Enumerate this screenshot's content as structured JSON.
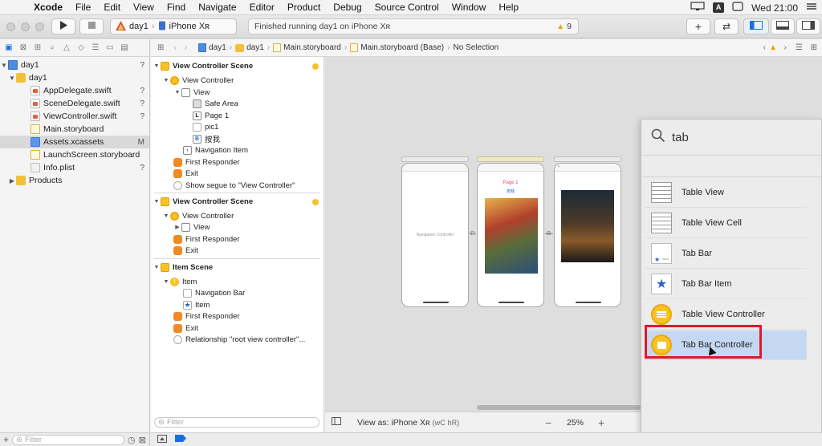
{
  "menubar": {
    "app_name": "Xcode",
    "items": [
      "File",
      "Edit",
      "View",
      "Find",
      "Navigate",
      "Editor",
      "Product",
      "Debug",
      "Source Control",
      "Window",
      "Help"
    ],
    "input_badge": "A",
    "clock": "Wed 21:00"
  },
  "toolbar": {
    "scheme_name": "day1",
    "device_name": "iPhone Xʀ",
    "status_text": "Finished running day1 on iPhone Xʀ",
    "warning_count": "9"
  },
  "navigator": {
    "items": [
      {
        "label": "day1",
        "flag": "?"
      },
      {
        "label": "day1",
        "flag": ""
      },
      {
        "label": "AppDelegate.swift",
        "flag": "?"
      },
      {
        "label": "SceneDelegate.swift",
        "flag": "?"
      },
      {
        "label": "ViewController.swift",
        "flag": "?"
      },
      {
        "label": "Main.storyboard",
        "flag": ""
      },
      {
        "label": "Assets.xcassets",
        "flag": "M"
      },
      {
        "label": "LaunchScreen.storyboard",
        "flag": ""
      },
      {
        "label": "Info.plist",
        "flag": "?"
      },
      {
        "label": "Products",
        "flag": ""
      }
    ],
    "filter_placeholder": "Filter"
  },
  "jumpbar": {
    "crumbs": [
      "day1",
      "day1",
      "Main.storyboard",
      "Main.storyboard (Base)",
      "No Selection"
    ]
  },
  "outline": {
    "rows": [
      "View Controller Scene",
      "View Controller",
      "View",
      "Safe Area",
      "Page 1",
      "pic1",
      "按我",
      "Navigation Item",
      "First Responder",
      "Exit",
      "Show segue to \"View Controller\"",
      "View Controller Scene",
      "View Controller",
      "View",
      "First Responder",
      "Exit",
      "Item Scene",
      "Item",
      "Navigation Bar",
      "Item",
      "First Responder",
      "Exit",
      "Relationship \"root view controller\"..."
    ],
    "label_icon_letter": "L",
    "button_icon_letter": "B",
    "filter_placeholder": "Filter"
  },
  "canvas": {
    "nav_controller_label": "Navigation Controller",
    "page_label": "Page 1",
    "button_label": "按我",
    "view_as": "View as: iPhone Xʀ",
    "size_class_w": "wC",
    "size_class_h": "hR",
    "zoom": "25%"
  },
  "library": {
    "query": "tab",
    "results": [
      "Table View",
      "Table View Cell",
      "Tab Bar",
      "Tab Bar Item",
      "Table View Controller",
      "Tab Bar Controller"
    ]
  },
  "colors": {
    "accent": "#1a6fe0",
    "highlight_box": "#e0182b",
    "selection": "#c5d8f3",
    "vc_yellow": "#f6c324"
  }
}
